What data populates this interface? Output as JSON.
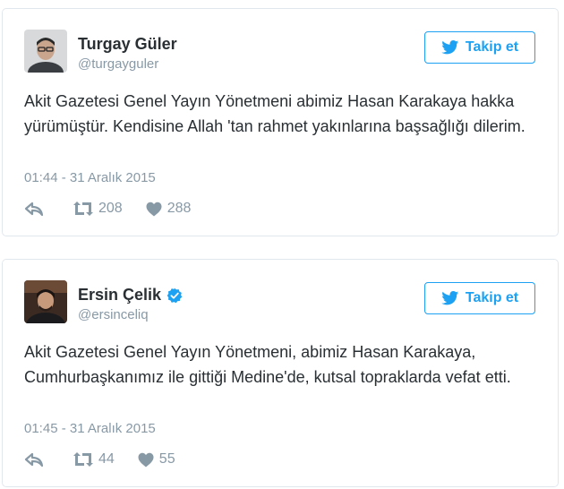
{
  "tweets": [
    {
      "name": "Turgay Güler",
      "handle": "@turgayguler",
      "verified": false,
      "follow_label": "Takip et",
      "text": "Akit Gazetesi Genel Yayın Yönetmeni abimiz Hasan Karakaya hakka yürümüştür. Kendisine Allah 'tan rahmet yakınlarına başsağlığı dilerim.",
      "timestamp": "01:44 - 31 Aralık 2015",
      "retweets": "208",
      "likes": "288"
    },
    {
      "name": "Ersin Çelik",
      "handle": "@ersinceliq",
      "verified": true,
      "follow_label": "Takip et",
      "text": "Akit Gazetesi Genel Yayın Yönetmeni, abimiz Hasan Karakaya, Cumhurbaşkanımız ile gittiği Medine'de, kutsal topraklarda vefat etti.",
      "timestamp": "01:45 - 31 Aralık 2015",
      "retweets": "44",
      "likes": "55"
    }
  ],
  "colors": {
    "accent": "#1da1f2",
    "text": "#292f33",
    "muted": "#8899a6",
    "border": "#e1e8ed"
  },
  "icons": [
    "twitter-bird-icon",
    "verified-badge-icon",
    "reply-icon",
    "retweet-icon",
    "heart-icon"
  ]
}
